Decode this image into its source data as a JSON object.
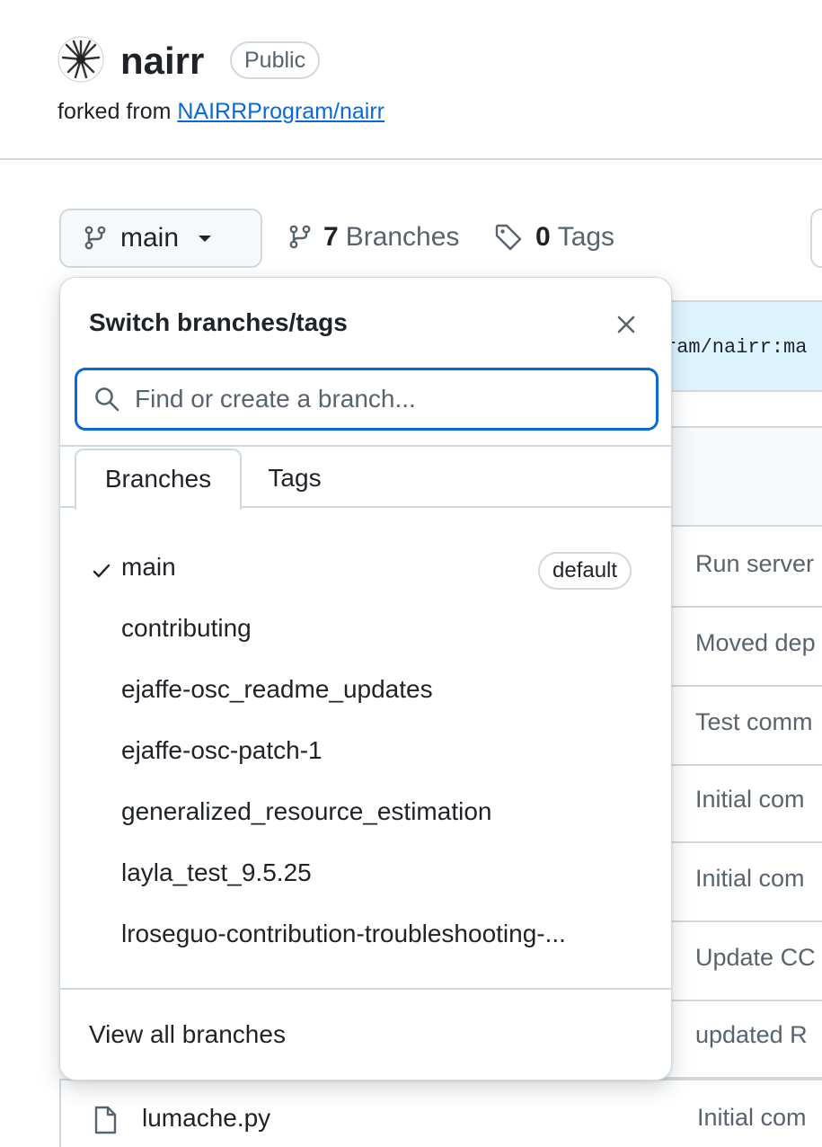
{
  "repo": {
    "name": "nairr",
    "visibility": "Public",
    "forked_from_prefix": "forked from ",
    "forked_from_link": "NAIRRProgram/nairr"
  },
  "toolbar": {
    "current_branch": "main",
    "branches_count": "7",
    "branches_label": "Branches",
    "tags_count": "0",
    "tags_label": "Tags"
  },
  "fork_banner": {
    "text": "ram/nairr:ma"
  },
  "dropdown": {
    "title": "Switch branches/tags",
    "search_placeholder": "Find or create a branch...",
    "tabs": [
      "Branches",
      "Tags"
    ],
    "branches": [
      {
        "name": "main",
        "selected": true,
        "badge": "default"
      },
      {
        "name": "contributing"
      },
      {
        "name": "ejaffe-osc_readme_updates"
      },
      {
        "name": "ejaffe-osc-patch-1"
      },
      {
        "name": "generalized_resource_estimation"
      },
      {
        "name": "layla_test_9.5.25"
      },
      {
        "name": "lroseguo-contribution-troubleshooting-..."
      }
    ],
    "view_all": "View all branches"
  },
  "commits": [
    "Run server",
    "Moved dep",
    "Test comm",
    "Initial com",
    "Initial com",
    "Update CC",
    "updated R"
  ],
  "file_row": {
    "name": "lumache.py",
    "commit": "Initial com"
  },
  "colors": {
    "accent": "#0969da",
    "border": "#d1d9e0",
    "muted": "#59636e",
    "banner": "#ddf4ff"
  }
}
